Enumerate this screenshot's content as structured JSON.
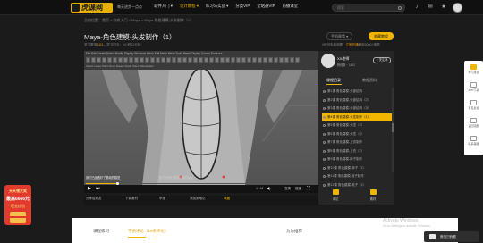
{
  "header": {
    "logo": "虎课网",
    "tagline": "每天进步一点点",
    "nav": [
      {
        "label": "软件入门 ▾",
        "hot": false
      },
      {
        "label": "设计教程 ▾",
        "hot": true
      },
      {
        "label": "练习与实战 ▾",
        "hot": false
      },
      {
        "label": "分类VIP",
        "hot": false
      },
      {
        "label": "全站通VIP",
        "hot": false
      },
      {
        "label": "前播课堂",
        "hot": false
      }
    ],
    "search_placeholder": "搜索",
    "icons": [
      "search-icon",
      "bell-icon",
      "star-icon",
      "user-icon"
    ]
  },
  "breadcrumb": "当前位置：首页 > 软件入门 > Maya > Maya-角色建模-头发制作（1）",
  "video_title": "Maya-角色建模-头发制作（1）",
  "meta": {
    "prefix": "学习数量",
    "highlight": "1111",
    "suffix": "，学习时长：1小时12分钟"
  },
  "phone_button": "手机观看 ▾",
  "fav_button": "收藏教程",
  "vip_note": {
    "prefix": "VIP可免费观看，",
    "highlight": "立即开通",
    "suffix": "解锁3000+视频"
  },
  "maya_ui": {
    "menu": "File  Edit  Create  Select  Modify  Display  Windows  Mesh  Edit Mesh  Mesh Tools  Mesh Display  Curves  Surfaces",
    "tools_row": "Select   Lasso   Paint   Move   Rotate   Scale   Show Manipulator"
  },
  "subtitle_text": "我们已经做好了基础的模型",
  "subtitle_text2": "接下来我们要做头发的部分",
  "player": {
    "play": "▶",
    "next": "⏭",
    "progress": 0.14,
    "time": "11:44",
    "quality": "高清",
    "speed": "倍速",
    "danmaku": "弹幕"
  },
  "below_video": [
    {
      "label": "分享给朋友",
      "y": false
    },
    {
      "label": "下载素材",
      "y": false
    },
    {
      "label": "举报",
      "y": false
    },
    {
      "label": "添加到笔记",
      "y": false
    },
    {
      "label": "收藏",
      "y": true
    }
  ],
  "teacher": {
    "name": "XX老师",
    "sub": "教程数：1552",
    "follow": "+ 关注我"
  },
  "panel_tabs": [
    "课程目录",
    "教程资料"
  ],
  "chapters": [
    {
      "label": "第1课 角色建模-头部结构",
      "on": false
    },
    {
      "label": "第2课 角色建模-头部结构（2）",
      "on": false
    },
    {
      "label": "第3课 角色建模-头部结构（3）",
      "on": false
    },
    {
      "label": "第4课 角色建模-头发制作（1）",
      "on": true
    },
    {
      "label": "第5课 角色建模-头发（2）",
      "on": false
    },
    {
      "label": "第6课 角色建模-头发（3）",
      "on": false
    },
    {
      "label": "第7课 角色建模-上衣制作",
      "on": false
    },
    {
      "label": "第8课 角色建模-上衣（2）",
      "on": false
    },
    {
      "label": "第9课 角色建模-裤子制作",
      "on": false
    },
    {
      "label": "第10课 角色建模-裤子（2）",
      "on": false
    },
    {
      "label": "第11课 角色建模-鞋子制作",
      "on": false
    },
    {
      "label": "第12课 角色建模-鞋子（2）",
      "on": false
    }
  ],
  "panel_buttons": [
    "评论",
    "素材"
  ],
  "bottom_tabs": [
    {
      "label": "课程练习",
      "on": false
    },
    {
      "label": "学员评论（10条评论）",
      "on": true
    },
    {
      "label": "为你推荐",
      "on": false
    }
  ],
  "watermark": {
    "line1": "Activate Windows",
    "line2": "Go to Settings to activate Windows."
  },
  "side_tools": [
    {
      "label": "学习建议",
      "y": true
    },
    {
      "label": "APP下载",
      "y": false
    },
    {
      "label": "意见反馈",
      "y": false
    },
    {
      "label": "返回顶部",
      "y": false
    },
    {
      "label": "联系客服",
      "y": false
    }
  ],
  "promo": {
    "line1": "天天领大奖",
    "line2": "最高6666元",
    "line3": "现金红包"
  },
  "wechat": "微信扫码看"
}
